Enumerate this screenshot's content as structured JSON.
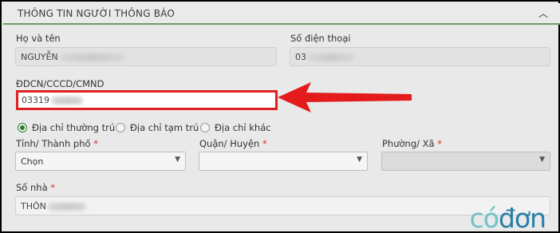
{
  "section": {
    "title": "THÔNG TIN NGƯỜI THÔNG BÁO"
  },
  "fields": {
    "ho_ten": {
      "label": "Họ và tên",
      "value": "NGUYỄN"
    },
    "so_dien_thoai": {
      "label": "Số điện thoại",
      "value": "03"
    },
    "cccd": {
      "label": "ĐDCN/CCCD/CMND",
      "value": "03319"
    },
    "so_nha": {
      "label": "Số nhà",
      "required_mark": "*",
      "value": "THÔN"
    }
  },
  "address_type": {
    "options": [
      {
        "label": "Địa chỉ thường trú",
        "selected": true
      },
      {
        "label": "Địa chỉ tạm trú",
        "selected": false
      },
      {
        "label": "Địa chỉ khác",
        "selected": false
      }
    ]
  },
  "selects": {
    "tinh": {
      "label": "Tỉnh/ Thành phố",
      "required_mark": "*",
      "value": "Chọn"
    },
    "quan": {
      "label": "Quận/ Huyện",
      "required_mark": "*",
      "value": ""
    },
    "phuong": {
      "label": "Phường/ Xã",
      "required_mark": "*",
      "value": ""
    }
  },
  "watermark": {
    "part1": "có",
    "part2": "đơn"
  },
  "colors": {
    "accent_green": "#2e7d32",
    "highlight_red": "#e02020"
  }
}
